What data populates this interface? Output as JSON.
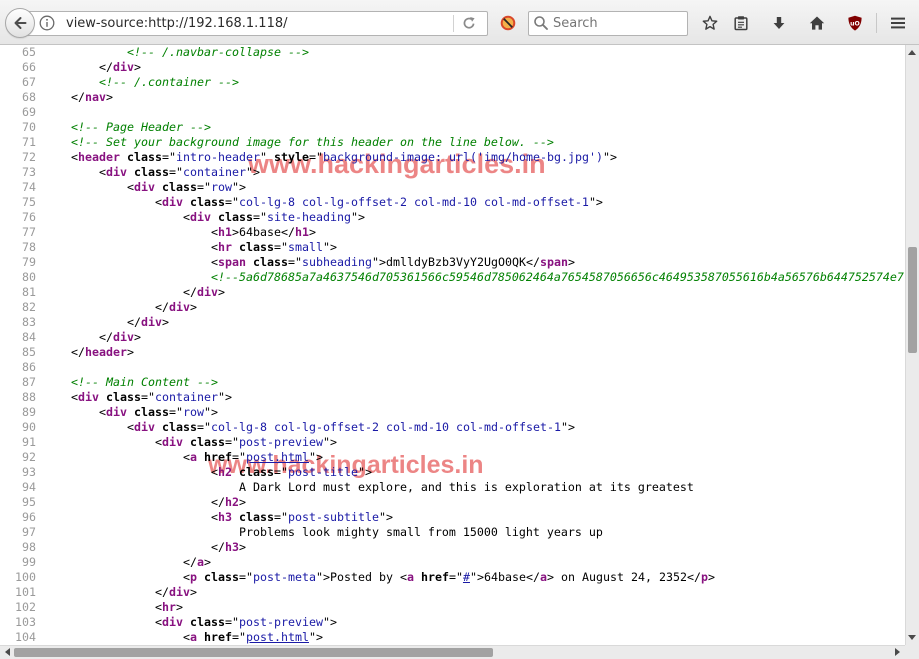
{
  "browser": {
    "url": "view-source:http://192.168.1.118/",
    "search_placeholder": "Search",
    "ublock_logo_text": "uO"
  },
  "watermark": {
    "text": "www.hackingarticles.in"
  },
  "source": {
    "lines": [
      {
        "n": 65,
        "tokens": [
          {
            "text": "            "
          },
          {
            "comment": "<!-- /.navbar-collapse -->"
          }
        ]
      },
      {
        "n": 66,
        "tokens": [
          {
            "text": "        </"
          },
          {
            "tag": "div"
          },
          {
            "text": ">"
          }
        ]
      },
      {
        "n": 67,
        "tokens": [
          {
            "text": "        "
          },
          {
            "comment": "<!-- /.container -->"
          }
        ]
      },
      {
        "n": 68,
        "tokens": [
          {
            "text": "    </"
          },
          {
            "tag": "nav"
          },
          {
            "text": ">"
          }
        ]
      },
      {
        "n": 69,
        "tokens": []
      },
      {
        "n": 70,
        "tokens": [
          {
            "text": "    "
          },
          {
            "comment": "<!-- Page Header -->"
          }
        ]
      },
      {
        "n": 71,
        "tokens": [
          {
            "text": "    "
          },
          {
            "comment": "<!-- Set your background image for this header on the line below. -->"
          }
        ]
      },
      {
        "n": 72,
        "tokens": [
          {
            "text": "    <"
          },
          {
            "tag": "header"
          },
          {
            "text": " "
          },
          {
            "attr": "class"
          },
          {
            "text": "=\""
          },
          {
            "value": "intro-header"
          },
          {
            "text": "\" "
          },
          {
            "attr": "style"
          },
          {
            "text": "=\""
          },
          {
            "value": "background-image: url('img/home-bg.jpg')"
          },
          {
            "text": "\">"
          }
        ]
      },
      {
        "n": 73,
        "tokens": [
          {
            "text": "        <"
          },
          {
            "tag": "div"
          },
          {
            "text": " "
          },
          {
            "attr": "class"
          },
          {
            "text": "=\""
          },
          {
            "value": "container"
          },
          {
            "text": "\">"
          }
        ]
      },
      {
        "n": 74,
        "tokens": [
          {
            "text": "            <"
          },
          {
            "tag": "div"
          },
          {
            "text": " "
          },
          {
            "attr": "class"
          },
          {
            "text": "=\""
          },
          {
            "value": "row"
          },
          {
            "text": "\">"
          }
        ]
      },
      {
        "n": 75,
        "tokens": [
          {
            "text": "                <"
          },
          {
            "tag": "div"
          },
          {
            "text": " "
          },
          {
            "attr": "class"
          },
          {
            "text": "=\""
          },
          {
            "value": "col-lg-8 col-lg-offset-2 col-md-10 col-md-offset-1"
          },
          {
            "text": "\">"
          }
        ]
      },
      {
        "n": 76,
        "tokens": [
          {
            "text": "                    <"
          },
          {
            "tag": "div"
          },
          {
            "text": " "
          },
          {
            "attr": "class"
          },
          {
            "text": "=\""
          },
          {
            "value": "site-heading"
          },
          {
            "text": "\">"
          }
        ]
      },
      {
        "n": 77,
        "tokens": [
          {
            "text": "                        <"
          },
          {
            "tag": "h1"
          },
          {
            "text": ">64base</"
          },
          {
            "tag": "h1"
          },
          {
            "text": ">"
          }
        ]
      },
      {
        "n": 78,
        "tokens": [
          {
            "text": "                        <"
          },
          {
            "tag": "hr"
          },
          {
            "text": " "
          },
          {
            "attr": "class"
          },
          {
            "text": "=\""
          },
          {
            "value": "small"
          },
          {
            "text": "\">"
          }
        ]
      },
      {
        "n": 79,
        "tokens": [
          {
            "text": "                        <"
          },
          {
            "tag": "span"
          },
          {
            "text": " "
          },
          {
            "attr": "class"
          },
          {
            "text": "=\""
          },
          {
            "value": "subheading"
          },
          {
            "text": "\">dmlldyBzb3VyY2UgO0QK</"
          },
          {
            "tag": "span"
          },
          {
            "text": ">"
          }
        ]
      },
      {
        "n": 80,
        "tokens": [
          {
            "text": "                        "
          },
          {
            "comment": "<!--5a6d78685a7a4637546d705361566c59546d785062464a7654587056656c464953587055616b4a56576b644752574e7"
          }
        ]
      },
      {
        "n": 81,
        "tokens": [
          {
            "text": "                    </"
          },
          {
            "tag": "div"
          },
          {
            "text": ">"
          }
        ]
      },
      {
        "n": 82,
        "tokens": [
          {
            "text": "                </"
          },
          {
            "tag": "div"
          },
          {
            "text": ">"
          }
        ]
      },
      {
        "n": 83,
        "tokens": [
          {
            "text": "            </"
          },
          {
            "tag": "div"
          },
          {
            "text": ">"
          }
        ]
      },
      {
        "n": 84,
        "tokens": [
          {
            "text": "        </"
          },
          {
            "tag": "div"
          },
          {
            "text": ">"
          }
        ]
      },
      {
        "n": 85,
        "tokens": [
          {
            "text": "    </"
          },
          {
            "tag": "header"
          },
          {
            "text": ">"
          }
        ]
      },
      {
        "n": 86,
        "tokens": []
      },
      {
        "n": 87,
        "tokens": [
          {
            "text": "    "
          },
          {
            "comment": "<!-- Main Content -->"
          }
        ]
      },
      {
        "n": 88,
        "tokens": [
          {
            "text": "    <"
          },
          {
            "tag": "div"
          },
          {
            "text": " "
          },
          {
            "attr": "class"
          },
          {
            "text": "=\""
          },
          {
            "value": "container"
          },
          {
            "text": "\">"
          }
        ]
      },
      {
        "n": 89,
        "tokens": [
          {
            "text": "        <"
          },
          {
            "tag": "div"
          },
          {
            "text": " "
          },
          {
            "attr": "class"
          },
          {
            "text": "=\""
          },
          {
            "value": "row"
          },
          {
            "text": "\">"
          }
        ]
      },
      {
        "n": 90,
        "tokens": [
          {
            "text": "            <"
          },
          {
            "tag": "div"
          },
          {
            "text": " "
          },
          {
            "attr": "class"
          },
          {
            "text": "=\""
          },
          {
            "value": "col-lg-8 col-lg-offset-2 col-md-10 col-md-offset-1"
          },
          {
            "text": "\">"
          }
        ]
      },
      {
        "n": 91,
        "tokens": [
          {
            "text": "                <"
          },
          {
            "tag": "div"
          },
          {
            "text": " "
          },
          {
            "attr": "class"
          },
          {
            "text": "=\""
          },
          {
            "value": "post-preview"
          },
          {
            "text": "\">"
          }
        ]
      },
      {
        "n": 92,
        "tokens": [
          {
            "text": "                    <"
          },
          {
            "tag": "a"
          },
          {
            "text": " "
          },
          {
            "attr": "href"
          },
          {
            "text": "=\""
          },
          {
            "link": "post.html"
          },
          {
            "text": "\">"
          }
        ]
      },
      {
        "n": 93,
        "tokens": [
          {
            "text": "                        <"
          },
          {
            "tag": "h2"
          },
          {
            "text": " "
          },
          {
            "attr": "class"
          },
          {
            "text": "=\""
          },
          {
            "value": "post-title"
          },
          {
            "text": "\">"
          }
        ]
      },
      {
        "n": 94,
        "tokens": [
          {
            "text": "                            A Dark Lord must explore, and this is exploration at its greatest"
          }
        ]
      },
      {
        "n": 95,
        "tokens": [
          {
            "text": "                        </"
          },
          {
            "tag": "h2"
          },
          {
            "text": ">"
          }
        ]
      },
      {
        "n": 96,
        "tokens": [
          {
            "text": "                        <"
          },
          {
            "tag": "h3"
          },
          {
            "text": " "
          },
          {
            "attr": "class"
          },
          {
            "text": "=\""
          },
          {
            "value": "post-subtitle"
          },
          {
            "text": "\">"
          }
        ]
      },
      {
        "n": 97,
        "tokens": [
          {
            "text": "                            Problems look mighty small from 15000 light years up"
          }
        ]
      },
      {
        "n": 98,
        "tokens": [
          {
            "text": "                        </"
          },
          {
            "tag": "h3"
          },
          {
            "text": ">"
          }
        ]
      },
      {
        "n": 99,
        "tokens": [
          {
            "text": "                    </"
          },
          {
            "tag": "a"
          },
          {
            "text": ">"
          }
        ]
      },
      {
        "n": 100,
        "tokens": [
          {
            "text": "                    <"
          },
          {
            "tag": "p"
          },
          {
            "text": " "
          },
          {
            "attr": "class"
          },
          {
            "text": "=\""
          },
          {
            "value": "post-meta"
          },
          {
            "text": "\">Posted by <"
          },
          {
            "tag": "a"
          },
          {
            "text": " "
          },
          {
            "attr": "href"
          },
          {
            "text": "=\""
          },
          {
            "link": "#"
          },
          {
            "text": "\">64base</"
          },
          {
            "tag": "a"
          },
          {
            "text": "> on August 24, 2352</"
          },
          {
            "tag": "p"
          },
          {
            "text": ">"
          }
        ]
      },
      {
        "n": 101,
        "tokens": [
          {
            "text": "                </"
          },
          {
            "tag": "div"
          },
          {
            "text": ">"
          }
        ]
      },
      {
        "n": 102,
        "tokens": [
          {
            "text": "                <"
          },
          {
            "tag": "hr"
          },
          {
            "text": ">"
          }
        ]
      },
      {
        "n": 103,
        "tokens": [
          {
            "text": "                <"
          },
          {
            "tag": "div"
          },
          {
            "text": " "
          },
          {
            "attr": "class"
          },
          {
            "text": "=\""
          },
          {
            "value": "post-preview"
          },
          {
            "text": "\">"
          }
        ]
      },
      {
        "n": 104,
        "tokens": [
          {
            "text": "                    <"
          },
          {
            "tag": "a"
          },
          {
            "text": " "
          },
          {
            "attr": "href"
          },
          {
            "text": "=\""
          },
          {
            "link": "post.html"
          },
          {
            "text": "\">"
          }
        ]
      }
    ]
  }
}
